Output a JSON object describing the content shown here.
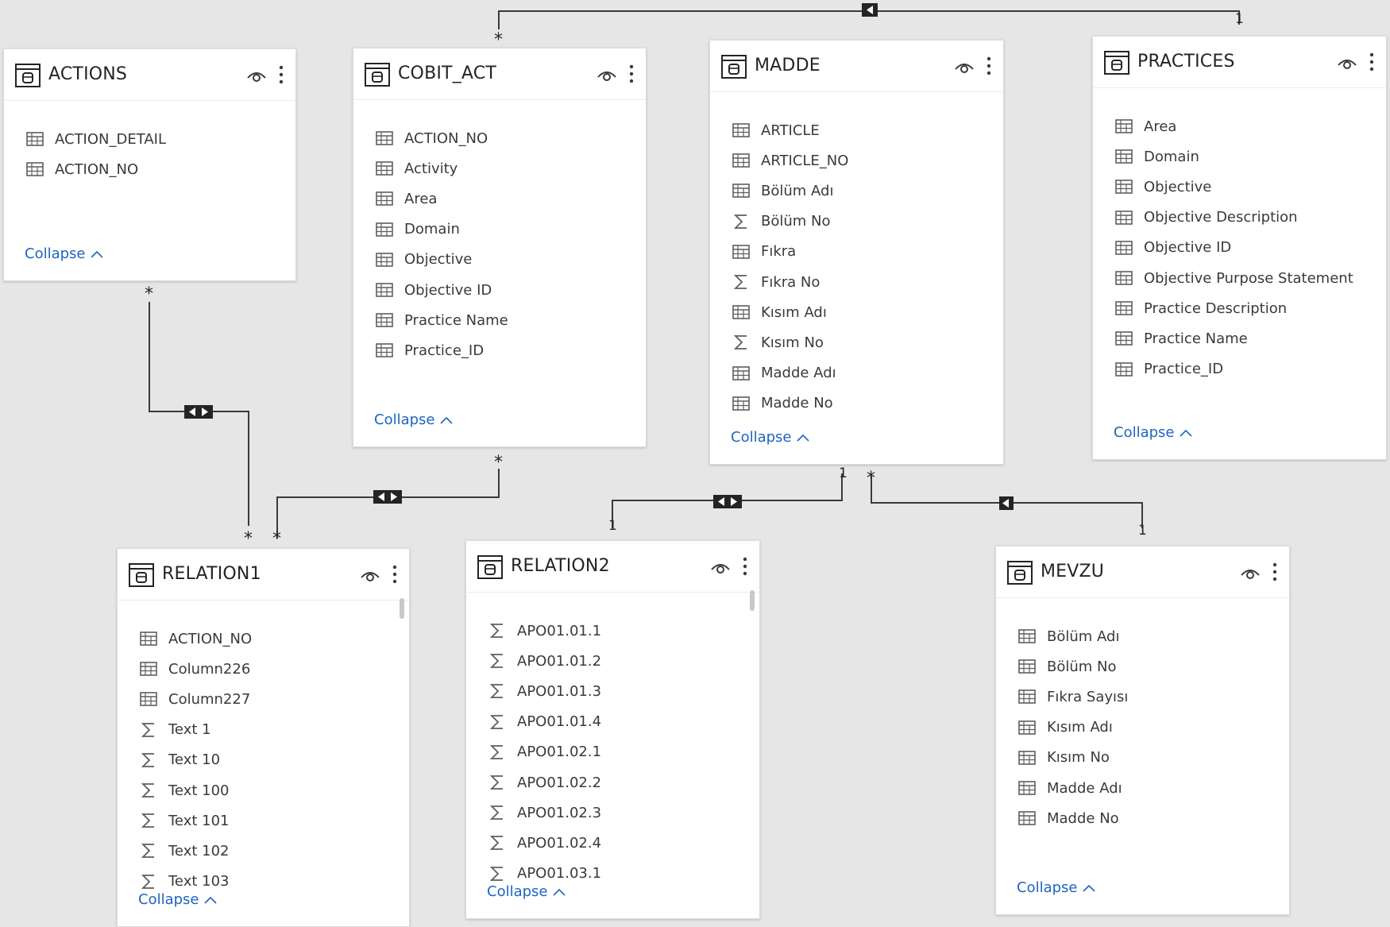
{
  "cards": [
    {
      "key": "actions",
      "title": "ACTIONS",
      "fields": [
        {
          "label": "ACTION_DETAIL",
          "icon": "table-field-icon"
        },
        {
          "label": "ACTION_NO",
          "icon": "table-field-icon"
        }
      ],
      "collapse": "Collapse"
    },
    {
      "key": "cobit_act",
      "title": "COBIT_ACT",
      "fields": [
        {
          "label": "ACTION_NO",
          "icon": "table-field-icon"
        },
        {
          "label": "Activity",
          "icon": "table-field-icon"
        },
        {
          "label": "Area",
          "icon": "table-field-icon"
        },
        {
          "label": "Domain",
          "icon": "table-field-icon"
        },
        {
          "label": "Objective",
          "icon": "table-field-icon"
        },
        {
          "label": "Objective ID",
          "icon": "table-field-icon"
        },
        {
          "label": "Practice Name",
          "icon": "table-field-icon"
        },
        {
          "label": "Practice_ID",
          "icon": "table-field-icon"
        }
      ],
      "collapse": "Collapse"
    },
    {
      "key": "madde",
      "title": "MADDE",
      "fields": [
        {
          "label": "ARTICLE",
          "icon": "table-field-icon"
        },
        {
          "label": "ARTICLE_NO",
          "icon": "table-field-icon"
        },
        {
          "label": "Bölüm Adı",
          "icon": "table-field-icon"
        },
        {
          "label": "Bölüm No",
          "icon": "sigma-icon"
        },
        {
          "label": "Fıkra",
          "icon": "table-field-icon"
        },
        {
          "label": "Fıkra No",
          "icon": "sigma-icon"
        },
        {
          "label": "Kısım Adı",
          "icon": "table-field-icon"
        },
        {
          "label": "Kısım No",
          "icon": "sigma-icon"
        },
        {
          "label": "Madde Adı",
          "icon": "table-field-icon"
        },
        {
          "label": "Madde No",
          "icon": "table-field-icon"
        }
      ],
      "collapse": "Collapse"
    },
    {
      "key": "practices",
      "title": "PRACTICES",
      "fields": [
        {
          "label": "Area",
          "icon": "table-field-icon"
        },
        {
          "label": "Domain",
          "icon": "table-field-icon"
        },
        {
          "label": "Objective",
          "icon": "table-field-icon"
        },
        {
          "label": "Objective Description",
          "icon": "table-field-icon"
        },
        {
          "label": "Objective ID",
          "icon": "table-field-icon"
        },
        {
          "label": "Objective Purpose Statement",
          "icon": "table-field-icon"
        },
        {
          "label": "Practice Description",
          "icon": "table-field-icon"
        },
        {
          "label": "Practice Name",
          "icon": "table-field-icon"
        },
        {
          "label": "Practice_ID",
          "icon": "table-field-icon"
        }
      ],
      "collapse": "Collapse"
    },
    {
      "key": "relation1",
      "title": "RELATION1",
      "fields": [
        {
          "label": "ACTION_NO",
          "icon": "table-field-icon"
        },
        {
          "label": "Column226",
          "icon": "table-field-icon"
        },
        {
          "label": "Column227",
          "icon": "table-field-icon"
        },
        {
          "label": "Text 1",
          "icon": "sigma-icon"
        },
        {
          "label": "Text 10",
          "icon": "sigma-icon"
        },
        {
          "label": "Text 100",
          "icon": "sigma-icon"
        },
        {
          "label": "Text 101",
          "icon": "sigma-icon"
        },
        {
          "label": "Text 102",
          "icon": "sigma-icon"
        },
        {
          "label": "Text 103",
          "icon": "sigma-icon"
        }
      ],
      "collapse": "Collapse"
    },
    {
      "key": "relation2",
      "title": "RELATION2",
      "fields": [
        {
          "label": "APO01.01.1",
          "icon": "sigma-icon"
        },
        {
          "label": "APO01.01.2",
          "icon": "sigma-icon"
        },
        {
          "label": "APO01.01.3",
          "icon": "sigma-icon"
        },
        {
          "label": "APO01.01.4",
          "icon": "sigma-icon"
        },
        {
          "label": "APO01.02.1",
          "icon": "sigma-icon"
        },
        {
          "label": "APO01.02.2",
          "icon": "sigma-icon"
        },
        {
          "label": "APO01.02.3",
          "icon": "sigma-icon"
        },
        {
          "label": "APO01.02.4",
          "icon": "sigma-icon"
        },
        {
          "label": "APO01.03.1",
          "icon": "sigma-icon"
        }
      ],
      "collapse": "Collapse"
    },
    {
      "key": "mevzu",
      "title": "MEVZU",
      "fields": [
        {
          "label": "Bölüm Adı",
          "icon": "table-field-icon"
        },
        {
          "label": "Bölüm No",
          "icon": "table-field-icon"
        },
        {
          "label": "Fıkra Sayısı",
          "icon": "table-field-icon"
        },
        {
          "label": "Kısım Adı",
          "icon": "table-field-icon"
        },
        {
          "label": "Kısım No",
          "icon": "table-field-icon"
        },
        {
          "label": "Madde Adı",
          "icon": "table-field-icon"
        },
        {
          "label": "Madde No",
          "icon": "table-field-icon"
        }
      ],
      "collapse": "Collapse"
    }
  ],
  "relationships": {
    "one_label": "1",
    "many_label": "*"
  },
  "colors": {
    "canvas": "#e6e6e6",
    "card": "#ffffff",
    "link": "#1f64c1",
    "line": "#252423"
  }
}
